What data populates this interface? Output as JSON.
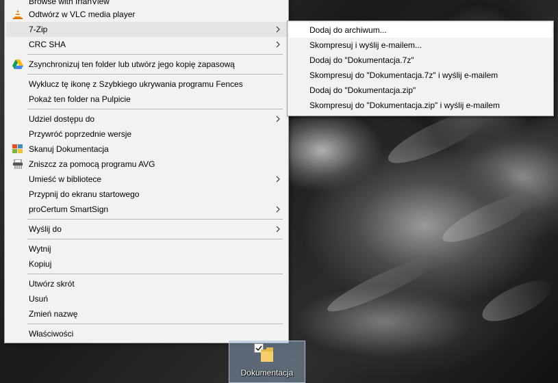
{
  "context_menu": {
    "items": [
      {
        "label": "Browse with IrfanView",
        "icon": "irfanview-icon",
        "has_submenu": false
      },
      {
        "label": "Odtwórz w VLC media player",
        "icon": "vlc-cone-icon",
        "has_submenu": false
      },
      {
        "label": "7-Zip",
        "icon": "",
        "has_submenu": true,
        "highlighted": true
      },
      {
        "label": "CRC SHA",
        "icon": "",
        "has_submenu": true
      },
      {
        "label": "Zsynchronizuj ten folder lub utwórz jego kopię zapasową",
        "icon": "google-drive-icon",
        "has_submenu": false
      },
      {
        "label": "Wyklucz tę ikonę z Szybkiego ukrywania programu Fences",
        "icon": "",
        "has_submenu": false
      },
      {
        "label": "Pokaż ten folder na Pulpicie",
        "icon": "",
        "has_submenu": false
      },
      {
        "label": "Udziel dostępu do",
        "icon": "",
        "has_submenu": true
      },
      {
        "label": "Przywróć poprzednie wersje",
        "icon": "",
        "has_submenu": false
      },
      {
        "label": "Skanuj Dokumentacja",
        "icon": "avg-icon",
        "has_submenu": false
      },
      {
        "label": "Zniszcz za pomocą programu AVG",
        "icon": "shredder-icon",
        "has_submenu": false
      },
      {
        "label": "Umieść w bibliotece",
        "icon": "",
        "has_submenu": true
      },
      {
        "label": "Przypnij do ekranu startowego",
        "icon": "",
        "has_submenu": false
      },
      {
        "label": "proCertum SmartSign",
        "icon": "",
        "has_submenu": true
      },
      {
        "label": "Wyślij do",
        "icon": "",
        "has_submenu": true
      },
      {
        "label": "Wytnij",
        "icon": "",
        "has_submenu": false
      },
      {
        "label": "Kopiuj",
        "icon": "",
        "has_submenu": false
      },
      {
        "label": "Utwórz skrót",
        "icon": "",
        "has_submenu": false
      },
      {
        "label": "Usuń",
        "icon": "",
        "has_submenu": false
      },
      {
        "label": "Zmień nazwę",
        "icon": "",
        "has_submenu": false
      },
      {
        "label": "Właściwości",
        "icon": "",
        "has_submenu": false
      }
    ]
  },
  "submenu_7zip": {
    "items": [
      {
        "label": "Dodaj do archiwum...",
        "highlighted": true
      },
      {
        "label": "Skompresuj i wyślij e-mailem..."
      },
      {
        "label": "Dodaj do \"Dokumentacja.7z\""
      },
      {
        "label": "Skompresuj do \"Dokumentacja.7z\" i wyślij e-mailem"
      },
      {
        "label": "Dodaj do \"Dokumentacja.zip\""
      },
      {
        "label": "Skompresuj do \"Dokumentacja.zip\" i wyślij e-mailem"
      }
    ]
  },
  "desktop": {
    "selected_icon": {
      "label": "Dokumentacja",
      "icon": "folder-icon",
      "checked": true
    }
  },
  "colors": {
    "menu_bg": "#f2f2f2",
    "menu_border": "#a0a0a0",
    "highlight": "#e5e5e5",
    "selection_tint": "#99b4d1"
  }
}
